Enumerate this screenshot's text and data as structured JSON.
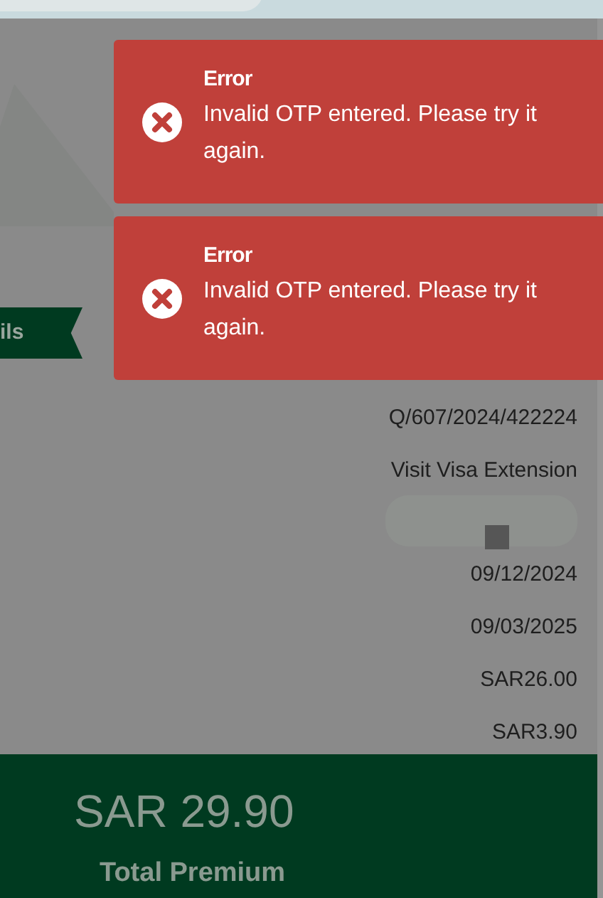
{
  "ribbon": {
    "label": "ils"
  },
  "toasts": [
    {
      "title": "Error",
      "message": "Invalid OTP entered. Please try it again."
    },
    {
      "title": "Error",
      "message": "Invalid OTP entered. Please try it again."
    }
  ],
  "details": [
    {
      "kind": "text",
      "value": "Q/607/2024/422224"
    },
    {
      "kind": "text",
      "value": "Visit Visa Extension"
    },
    {
      "kind": "redacted"
    },
    {
      "kind": "text",
      "value": "09/12/2024"
    },
    {
      "kind": "text",
      "value": "09/03/2025"
    },
    {
      "kind": "text",
      "value": "SAR26.00"
    },
    {
      "kind": "text",
      "value": "SAR3.90"
    }
  ],
  "total": {
    "amount": "SAR 29.90",
    "label": "Total Premium"
  }
}
